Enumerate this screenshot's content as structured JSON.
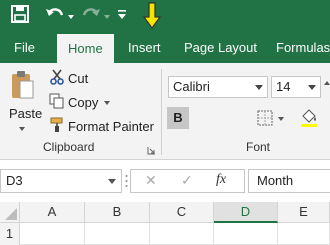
{
  "quick_access": {
    "save_icon": "save-icon",
    "undo_icon": "undo-icon",
    "redo_icon": "redo-icon",
    "customize_icon": "customize-qat-icon",
    "annotation_arrow": "down-arrow-icon"
  },
  "tabs": [
    {
      "label": "File"
    },
    {
      "label": "Home"
    },
    {
      "label": "Insert"
    },
    {
      "label": "Page Layout"
    },
    {
      "label": "Formulas"
    }
  ],
  "clipboard": {
    "paste": "Paste",
    "cut": "Cut",
    "copy": "Copy",
    "format_painter": "Format Painter",
    "group_label": "Clipboard"
  },
  "font": {
    "name": "Calibri",
    "size": "14",
    "bold": "B",
    "group_label": "Font"
  },
  "formula_bar": {
    "name_box": "D3",
    "cancel": "✕",
    "enter": "✓",
    "fx": "fx",
    "content": "Month"
  },
  "grid": {
    "columns": [
      "A",
      "B",
      "C",
      "D",
      "E"
    ],
    "rows": [
      "1"
    ]
  },
  "colors": {
    "brand": "#217346",
    "annotation": "#f5e600"
  }
}
